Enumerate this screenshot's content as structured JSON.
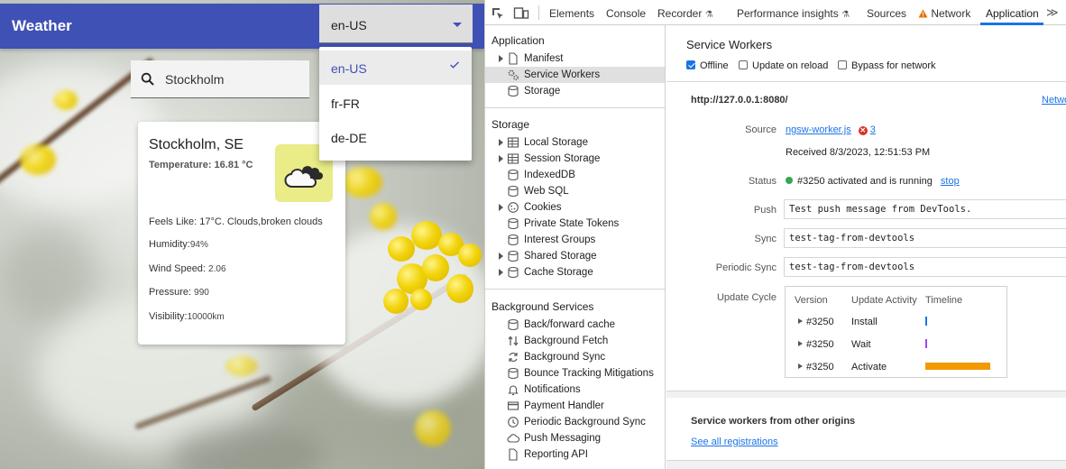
{
  "app": {
    "title": "Weather",
    "language_select": {
      "value": "en-US",
      "options": [
        "en-US",
        "fr-FR",
        "de-DE"
      ],
      "selected": "en-US"
    },
    "search": {
      "value": "Stockholm"
    },
    "card": {
      "city": "Stockholm, SE",
      "temperature": "Temperature: 16.81 °C",
      "feels_like": "Feels Like: 17°C. Clouds,broken clouds",
      "humidity_label": "Humidity:",
      "humidity_value": "94%",
      "wind_label": "Wind Speed:",
      "wind_value": "2.06",
      "pressure_label": "Pressure:",
      "pressure_value": "990",
      "visibility_label": "Visibility:",
      "visibility_value": "10000km",
      "icon": "cloud-icon"
    }
  },
  "devtools": {
    "tabs": [
      "Elements",
      "Console",
      "Recorder",
      "Performance insights",
      "Sources",
      "Network",
      "Application"
    ],
    "active_tab": "Application",
    "sidebar": {
      "application_header": "Application",
      "application_items": [
        "Manifest",
        "Service Workers",
        "Storage"
      ],
      "storage_header": "Storage",
      "storage_items": [
        "Local Storage",
        "Session Storage",
        "IndexedDB",
        "Web SQL",
        "Cookies",
        "Private State Tokens",
        "Interest Groups",
        "Shared Storage",
        "Cache Storage"
      ],
      "background_header": "Background Services",
      "background_items": [
        "Back/forward cache",
        "Background Fetch",
        "Background Sync",
        "Bounce Tracking Mitigations",
        "Notifications",
        "Payment Handler",
        "Periodic Background Sync",
        "Push Messaging",
        "Reporting API"
      ]
    },
    "service_workers": {
      "title": "Service Workers",
      "checkboxes": {
        "offline": "Offline",
        "update_on_reload": "Update on reload",
        "bypass_network": "Bypass for network"
      },
      "origin": "http://127.0.0.1:8080/",
      "network_link": "Netwo",
      "source_label": "Source",
      "source_file": "ngsw-worker.js",
      "source_errors": "3",
      "received": "Received 8/3/2023, 12:51:53 PM",
      "status_label": "Status",
      "status_text": "#3250 activated and is running",
      "stop_link": "stop",
      "push_label": "Push",
      "push_value": "Test push message from DevTools.",
      "sync_label": "Sync",
      "sync_value": "test-tag-from-devtools",
      "periodic_sync_label": "Periodic Sync",
      "periodic_sync_value": "test-tag-from-devtools",
      "update_cycle_label": "Update Cycle",
      "update_cycle": {
        "headers": [
          "Version",
          "Update Activity",
          "Timeline"
        ],
        "rows": [
          {
            "version": "#3250",
            "activity": "Install",
            "bar_color": "#1a73e8",
            "bar_fraction": 0.0
          },
          {
            "version": "#3250",
            "activity": "Wait",
            "bar_color": "#a142f4",
            "bar_fraction": 0.0
          },
          {
            "version": "#3250",
            "activity": "Activate",
            "bar_color": "#f29900",
            "bar_fraction": 1.0
          }
        ]
      },
      "other_origins_title": "Service workers from other origins",
      "see_all_link": "See all registrations"
    }
  }
}
